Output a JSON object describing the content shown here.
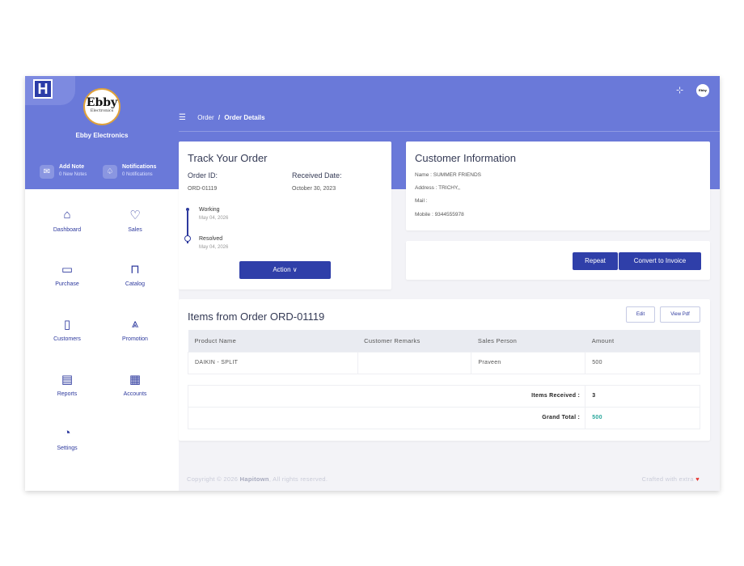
{
  "brand": {
    "logo_letter": "H",
    "circle_big": "Ebby",
    "circle_small": "Electronics",
    "name": "Ebby Electronics"
  },
  "quick_actions": [
    {
      "title": "Add Note",
      "subtitle": "0 New Notes",
      "icon": "mail-icon"
    },
    {
      "title": "Notifications",
      "subtitle": "0 Notifications",
      "icon": "bell-icon"
    }
  ],
  "nav": {
    "dashboard": "Dashboard",
    "sales": "Sales",
    "purchase": "Purchase",
    "catalog": "Catalog",
    "customers": "Customers",
    "promotion": "Promotion",
    "reports": "Reports",
    "accounts": "Accounts",
    "settings": "Settings"
  },
  "header": {
    "avatar_text": "Ebby",
    "breadcrumb_parent": "Order",
    "breadcrumb_sep": "/",
    "breadcrumb_current": "Order Details"
  },
  "track": {
    "title": "Track Your Order",
    "order_id_label": "Order ID:",
    "order_id": "ORD-01119",
    "received_label": "Received Date:",
    "received_date": "October 30, 2023",
    "timeline": [
      {
        "status": "Working",
        "date": "May 04, 2026"
      },
      {
        "status": "Resolved",
        "date": "May 04, 2026"
      }
    ],
    "action_label": "Action ∨"
  },
  "customer": {
    "title": "Customer Information",
    "name_row": "Name    : SUMMER FRIENDS",
    "address_row": "Address : TRICHY,,",
    "mail_row": "Mail      :",
    "mobile_row": "Mobile  : 9344555978"
  },
  "buttons": {
    "repeat": "Repeat",
    "convert": "Convert to Invoice",
    "edit": "Edit",
    "view_pdf": "View Pdf"
  },
  "items": {
    "title": "Items from Order ORD-01119",
    "columns": [
      "Product Name",
      "Customer Remarks",
      "Sales Person",
      "Amount"
    ],
    "rows": [
      {
        "product": "DAIKIN - SPLIT",
        "remarks": "",
        "sales_person": "Praveen",
        "amount": "500"
      }
    ],
    "items_received_label": "Items Received :",
    "items_received": "3",
    "grand_total_label": "Grand Total :",
    "grand_total": "500"
  },
  "footer": {
    "copyright_prefix": "Copyright © 2026 ",
    "company": "Hapitown",
    "copyright_suffix": ", All rights reserved.",
    "crafted": "Crafted with extra"
  },
  "colors": {
    "header": "#6a79d9",
    "primary": "#2f3fa9",
    "accent_total": "#26a69a"
  }
}
